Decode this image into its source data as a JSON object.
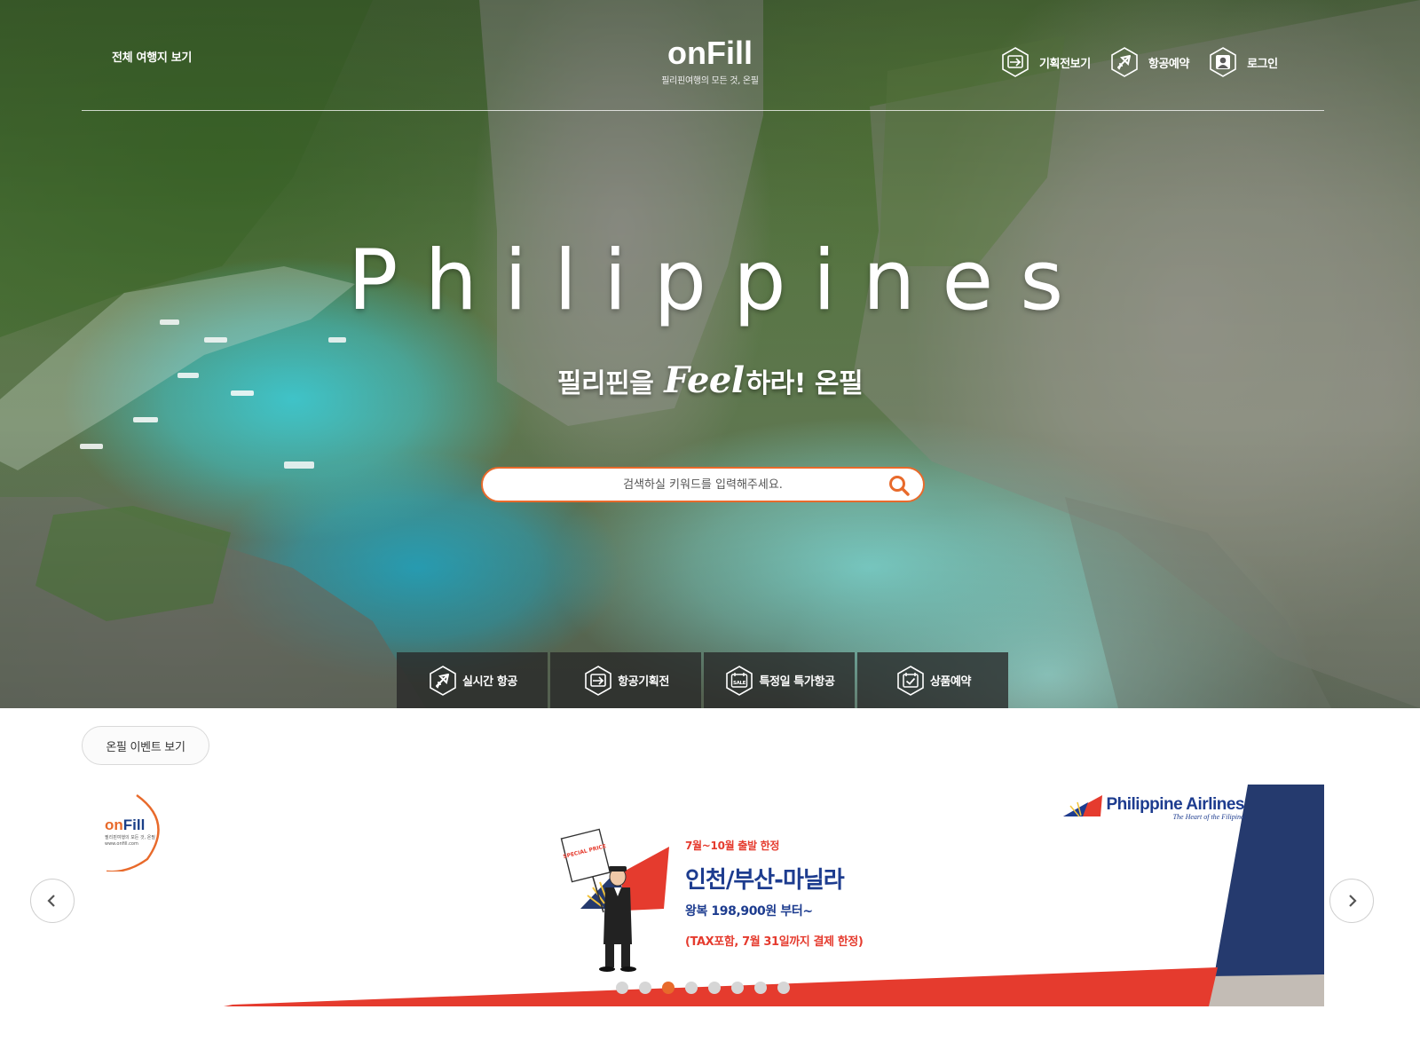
{
  "header": {
    "all_destinations_link": "전체 여행지 보기",
    "logo_text": "onFill",
    "logo_tagline": "필리핀여행의 모든 것, 온필",
    "nav": [
      {
        "label": "기획전보기",
        "icon": "plane-board-icon"
      },
      {
        "label": "항공예약",
        "icon": "airplane-icon"
      },
      {
        "label": "로그인",
        "icon": "user-icon"
      }
    ]
  },
  "hero": {
    "title": "Philippines",
    "subtitle_before": "필리핀을",
    "subtitle_feel": "Feel",
    "subtitle_after": "하라! 온필",
    "search_placeholder": "검색하실 키워드를 입력해주세요."
  },
  "quick_menu": [
    {
      "label": "실시간 항공",
      "icon": "airplane-icon"
    },
    {
      "label": "항공기획전",
      "icon": "plane-board-icon"
    },
    {
      "label": "특정일 특가항공",
      "icon": "sale-calendar-icon"
    },
    {
      "label": "상품예약",
      "icon": "calendar-check-icon"
    }
  ],
  "events": {
    "button_label": "온필 이벤트 보기",
    "banner": {
      "logo_word_a": "on",
      "logo_word_b": "Fill",
      "logo_sub_1": "필리핀여행의 모든 것, 온필",
      "logo_sub_2": "www.onfill.com",
      "airline_name": "Philippine Airlines",
      "airline_tagline": "The Heart of the Filipino",
      "sign_text": "SPECIAL PRICE",
      "promo_line1": "7월~10월 출발 한정",
      "promo_line2": "인천/부산-마닐라",
      "promo_line3": "왕복 198,900원 부터~",
      "promo_line4": "(TAX포함, 7월 31일까지 결제 한정)"
    },
    "slide_count": 8,
    "active_slide": 3
  },
  "colors": {
    "accent_orange": "#e86a2b",
    "pal_navy": "#1d3c8f",
    "promo_red": "#e53b2e",
    "quick_menu_bg": "#282828"
  }
}
